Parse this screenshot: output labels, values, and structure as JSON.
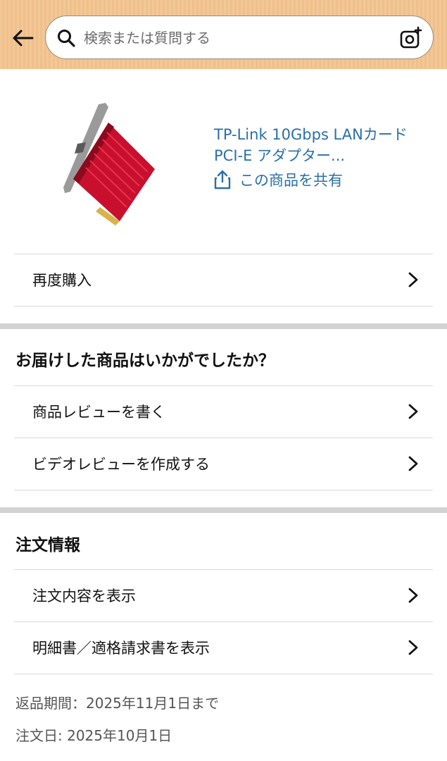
{
  "search": {
    "placeholder": "検索または質問する"
  },
  "product": {
    "title": "TP-Link 10Gbps LANカード PCI-E アダプター...",
    "share_label": "この商品を共有",
    "image_desc": "red network card"
  },
  "actions": {
    "buy_again": "再度購入"
  },
  "feedback": {
    "heading": "お届けした商品はいかがでしたか？",
    "write_review": "商品レビューを書く",
    "video_review": "ビデオレビューを作成する"
  },
  "order_info": {
    "heading": "注文情報",
    "view_order": "注文内容を表示",
    "view_invoice": "明細書／適格請求書を表示",
    "return_period": "返品期間：2025年11月1日まで",
    "order_date": "注文日: 2025年10月1日"
  },
  "colors": {
    "header_bg": "#f3c48f",
    "link": "#2a6fa8",
    "band": "#d3d3d3"
  },
  "icons": [
    "back-arrow-icon",
    "search-icon",
    "camera-icon",
    "share-icon",
    "chevron-right-icon"
  ]
}
